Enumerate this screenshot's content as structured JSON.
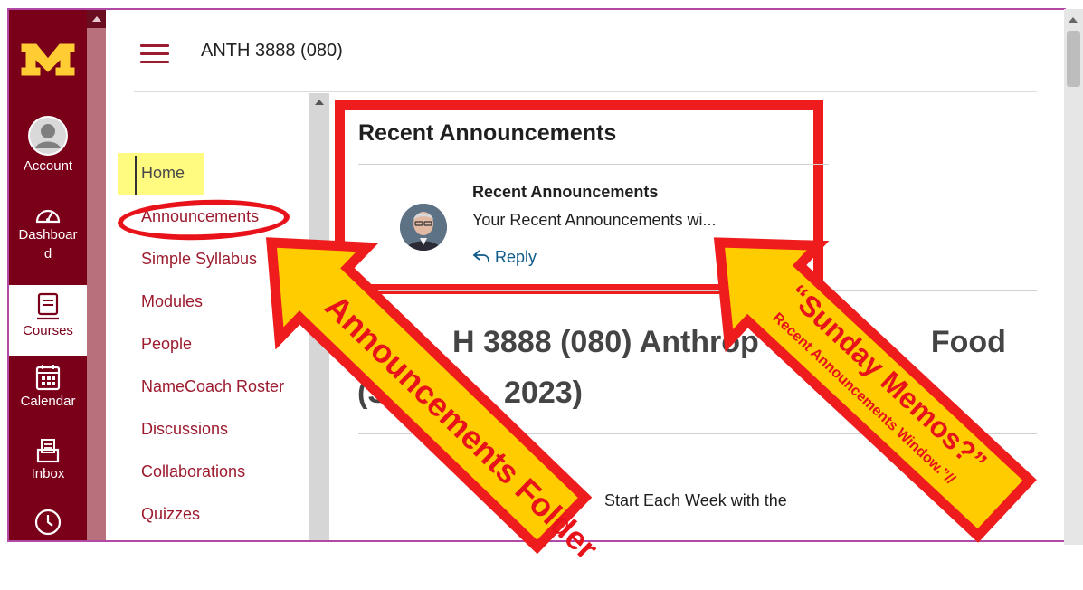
{
  "global_nav": {
    "logo": "M",
    "items": [
      {
        "label": "Account",
        "icon": "account-icon"
      },
      {
        "label": "Dashboar d",
        "label_line1": "Dashboar",
        "label_line2": "d",
        "icon": "dashboard-icon"
      },
      {
        "label": "Courses",
        "icon": "courses-icon",
        "active": true
      },
      {
        "label": "Calendar",
        "icon": "calendar-icon"
      },
      {
        "label": "Inbox",
        "icon": "inbox-icon"
      },
      {
        "label": "",
        "icon": "history-icon"
      }
    ]
  },
  "header": {
    "breadcrumb": "ANTH 3888 (080)"
  },
  "course_nav": {
    "items": [
      "Home",
      "Announcements",
      "Simple Syllabus",
      "Modules",
      "People",
      "NameCoach Roster",
      "Discussions",
      "Collaborations",
      "Quizzes"
    ],
    "active": "Home"
  },
  "announcements_widget": {
    "title": "Recent Announcements",
    "item": {
      "title": "Recent Announcements",
      "snippet": "Your Recent Announcements wi...",
      "reply": "Reply"
    }
  },
  "main": {
    "heading_line1": "H 3888 (080) Anthrop",
    "heading_line1_end": "Food",
    "heading_line2_start": "(S",
    "heading_line2_end": "2023)",
    "body_snippet": "Start Each Week with the"
  },
  "annotations": {
    "left_arrow": "Announcements Folder",
    "right_arrow_line1": "“Sunday Memos?”",
    "right_arrow_line2": "Recent Announcements Window.”//"
  },
  "colors": {
    "brand_maroon": "#7a0019",
    "link": "#9c1b2e",
    "highlight": "#fffb80",
    "annotation_red": "#ee1c1c",
    "annotation_yellow": "#ffcc00"
  }
}
